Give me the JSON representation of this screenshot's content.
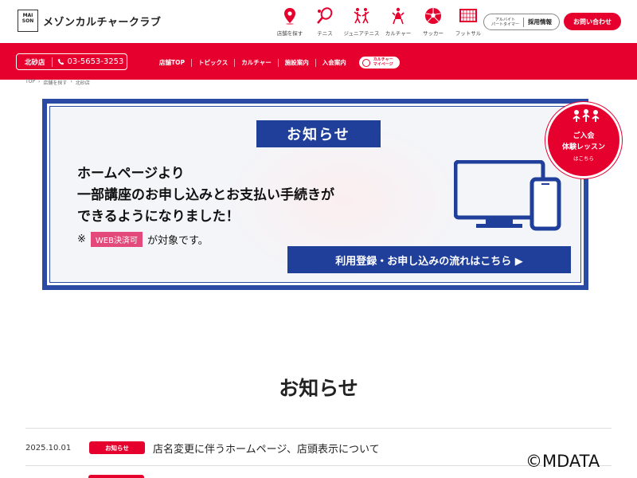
{
  "brand": {
    "logo_mark_line1": "MAI",
    "logo_mark_line2": "SON",
    "name": "メゾンカルチャークラブ"
  },
  "categories": [
    {
      "label": "店舗を探す",
      "icon": "map-pin-icon"
    },
    {
      "label": "テニス",
      "icon": "tennis-icon"
    },
    {
      "label": "ジュニアテニス",
      "icon": "junior-tennis-icon"
    },
    {
      "label": "カルチャー",
      "icon": "culture-icon"
    },
    {
      "label": "サッカー",
      "icon": "soccer-ball-icon"
    },
    {
      "label": "フットサル",
      "icon": "futsal-goal-icon"
    }
  ],
  "header": {
    "recruit_small_1": "アルバイト",
    "recruit_small_2": "パートタイマー",
    "recruit_label": "採用情報",
    "contact_label": "お問い合わせ"
  },
  "store": {
    "name": "北砂店",
    "phone": "03-5653-3253",
    "nav": [
      "店舗TOP",
      "トピックス",
      "カルチャー",
      "施設案内",
      "入会案内"
    ],
    "mypage_line1": "カルチャー",
    "mypage_line2": "マイページ"
  },
  "breadcrumb": [
    "TOP",
    "店舗を探す",
    "北砂店"
  ],
  "banner": {
    "title": "お知らせ",
    "lines": [
      "ホームページより",
      "一部講座のお申し込みとお支払い手続きが",
      "できるようになりました！"
    ],
    "note_prefix": "※",
    "note_tag": "WEB決済可",
    "note_suffix": "が対象です。",
    "cta": "利用登録・お申し込みの流れはこちら ▶"
  },
  "trial_badge": {
    "line1": "ご入会",
    "line2": "体験レッスン",
    "line3": "はこちら"
  },
  "news": {
    "heading": "お知らせ",
    "items": [
      {
        "date": "2025.10.01",
        "category": "お知らせ",
        "title": "店名変更に伴うホームページ、店頭表示について"
      }
    ]
  },
  "watermark": "©MDATA",
  "colors": {
    "brand_red": "#e6002d",
    "banner_blue": "#1f3f9a",
    "tag_pink": "#e3497b"
  }
}
